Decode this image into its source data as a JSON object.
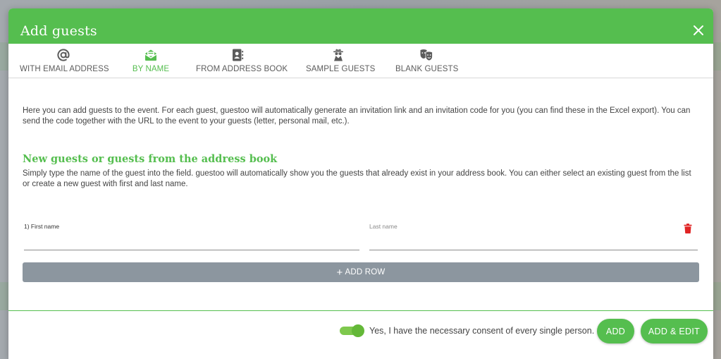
{
  "modal": {
    "title": "Add guests",
    "close_icon": "close-icon"
  },
  "tabs": [
    {
      "label": "WITH EMAIL ADDRESS",
      "icon": "at-sign-icon",
      "active": false
    },
    {
      "label": "BY NAME",
      "icon": "envelope-open-icon",
      "active": true
    },
    {
      "label": "FROM ADDRESS BOOK",
      "icon": "address-book-icon",
      "active": false
    },
    {
      "label": "SAMPLE GUESTS",
      "icon": "spy-icon",
      "active": false
    },
    {
      "label": "BLANK GUESTS",
      "icon": "theater-masks-icon",
      "active": false
    }
  ],
  "intro": {
    "text": "Here you can add guests to the event. For each guest, guestoo will automatically generate an invitation link and an invitation code for you (you can find these in the Excel export). You can send the code together with the URL to the event to your guests (letter, personal mail, etc.)."
  },
  "section": {
    "title": "New guests or guests from the address book",
    "description": "Simply type the name of the guest into the field. guestoo will automatically show you the guests that already exist in your address book. You can either select an existing guest from the list or create a new guest with first and last name."
  },
  "form": {
    "first_name_label": "1) First name",
    "first_name_value": "",
    "last_name_label": "Last name",
    "last_name_value": "",
    "delete_icon": "trash-icon",
    "add_row_label": "ADD ROW"
  },
  "footer": {
    "consent_text": "Yes, I have the necessary consent of every single person.",
    "consent_checked": true,
    "add_label": "ADD",
    "add_edit_label": "ADD & EDIT"
  },
  "colors": {
    "accent": "#55be4f",
    "add_row_bg": "#8c969f",
    "delete": "#e02424"
  }
}
